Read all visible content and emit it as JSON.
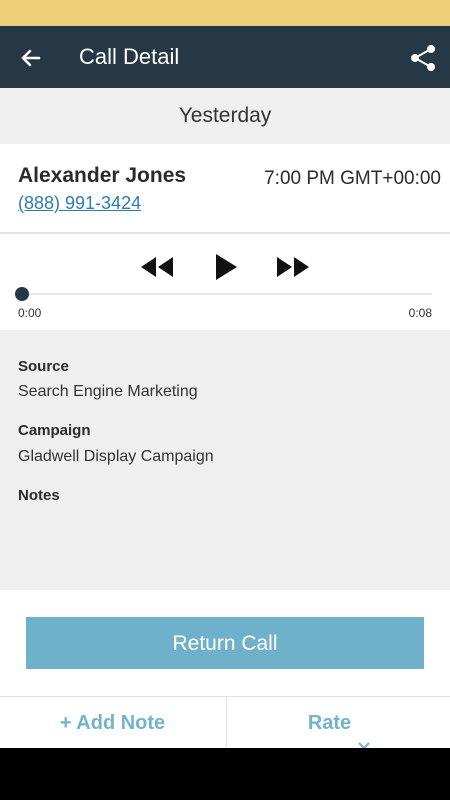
{
  "colors": {
    "status_bar": "#f0cf79",
    "app_bar": "#263846",
    "accent": "#6fb1cb",
    "link": "#2d7bb3",
    "panel_bg": "#efefef"
  },
  "app_bar": {
    "title": "Call Detail",
    "back_icon": "arrow-left-icon",
    "share_icon": "share-icon"
  },
  "date_header": "Yesterday",
  "caller": {
    "name": "Alexander Jones",
    "phone": "(888) 991-3424",
    "time": "7:00 PM GMT+00:00"
  },
  "player": {
    "controls": [
      "rewind-icon",
      "play-icon",
      "fast-forward-icon"
    ],
    "current_time": "0:00",
    "duration": "0:08",
    "progress": 0
  },
  "details": {
    "source_label": "Source",
    "source_value": "Search Engine Marketing",
    "campaign_label": "Campaign",
    "campaign_value": "Gladwell Display Campaign",
    "notes_label": "Notes"
  },
  "actions": {
    "return_call": "Return Call",
    "add_note": "+ Add Note",
    "rate": "Rate"
  }
}
